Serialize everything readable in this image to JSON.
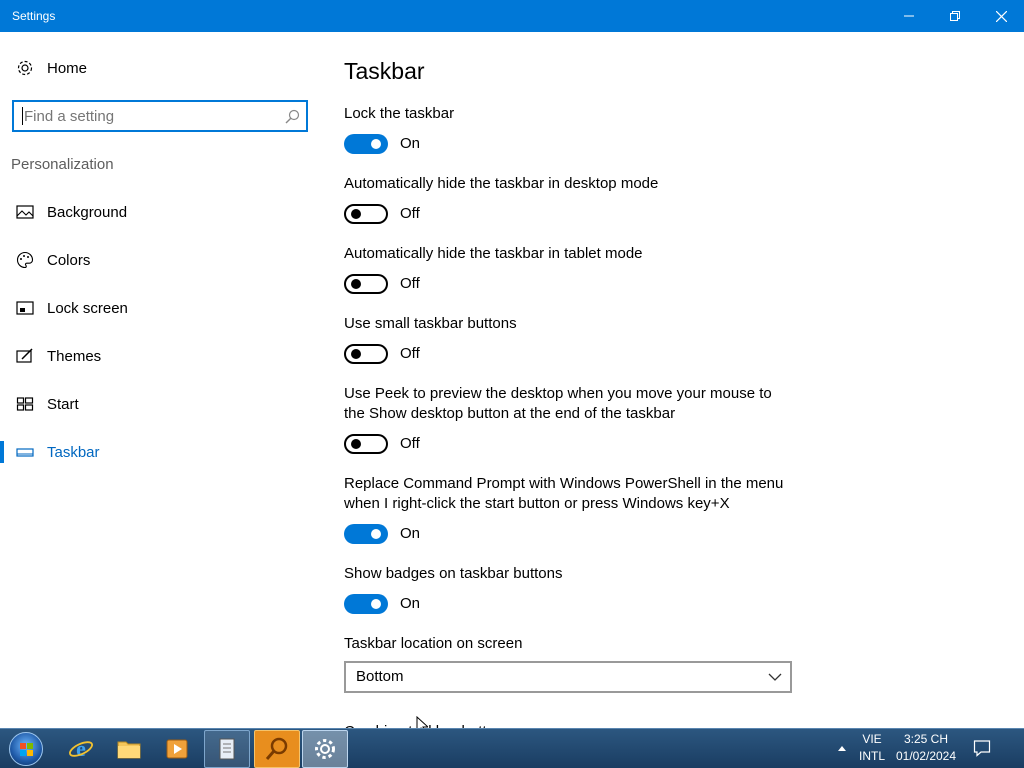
{
  "window": {
    "title": "Settings"
  },
  "sidebar": {
    "home_label": "Home",
    "search_placeholder": "Find a setting",
    "section": "Personalization",
    "items": [
      {
        "label": "Background",
        "icon": "picture-icon"
      },
      {
        "label": "Colors",
        "icon": "palette-icon"
      },
      {
        "label": "Lock screen",
        "icon": "lock-screen-icon"
      },
      {
        "label": "Themes",
        "icon": "themes-icon"
      },
      {
        "label": "Start",
        "icon": "start-icon"
      },
      {
        "label": "Taskbar",
        "icon": "taskbar-icon",
        "selected": true
      }
    ]
  },
  "main": {
    "title": "Taskbar",
    "settings": [
      {
        "label": "Lock the taskbar",
        "state": "On"
      },
      {
        "label": "Automatically hide the taskbar in desktop mode",
        "state": "Off"
      },
      {
        "label": "Automatically hide the taskbar in tablet mode",
        "state": "Off"
      },
      {
        "label": "Use small taskbar buttons",
        "state": "Off"
      },
      {
        "label": "Use Peek to preview the desktop when you move your mouse to the Show desktop button at the end of the taskbar",
        "state": "Off"
      },
      {
        "label": "Replace Command Prompt with Windows PowerShell in the menu when I right-click the start button or press Windows key+X",
        "state": "On"
      },
      {
        "label": "Show badges on taskbar buttons",
        "state": "On"
      }
    ],
    "location_label": "Taskbar location on screen",
    "location_value": "Bottom",
    "next_label_partial": "Combine taskbar buttons"
  },
  "taskbar": {
    "apps": [
      "start-orb",
      "internet-explorer-icon",
      "file-explorer-icon",
      "media-player-icon",
      "notepad-icon",
      "search-magnifier-icon",
      "settings-gear-icon"
    ],
    "language_top": "VIE",
    "language_bottom": "INTL",
    "time": "3:25 CH",
    "date": "01/02/2024"
  },
  "colors": {
    "accent": "#0078d7",
    "titlebar": "#0078d7"
  }
}
